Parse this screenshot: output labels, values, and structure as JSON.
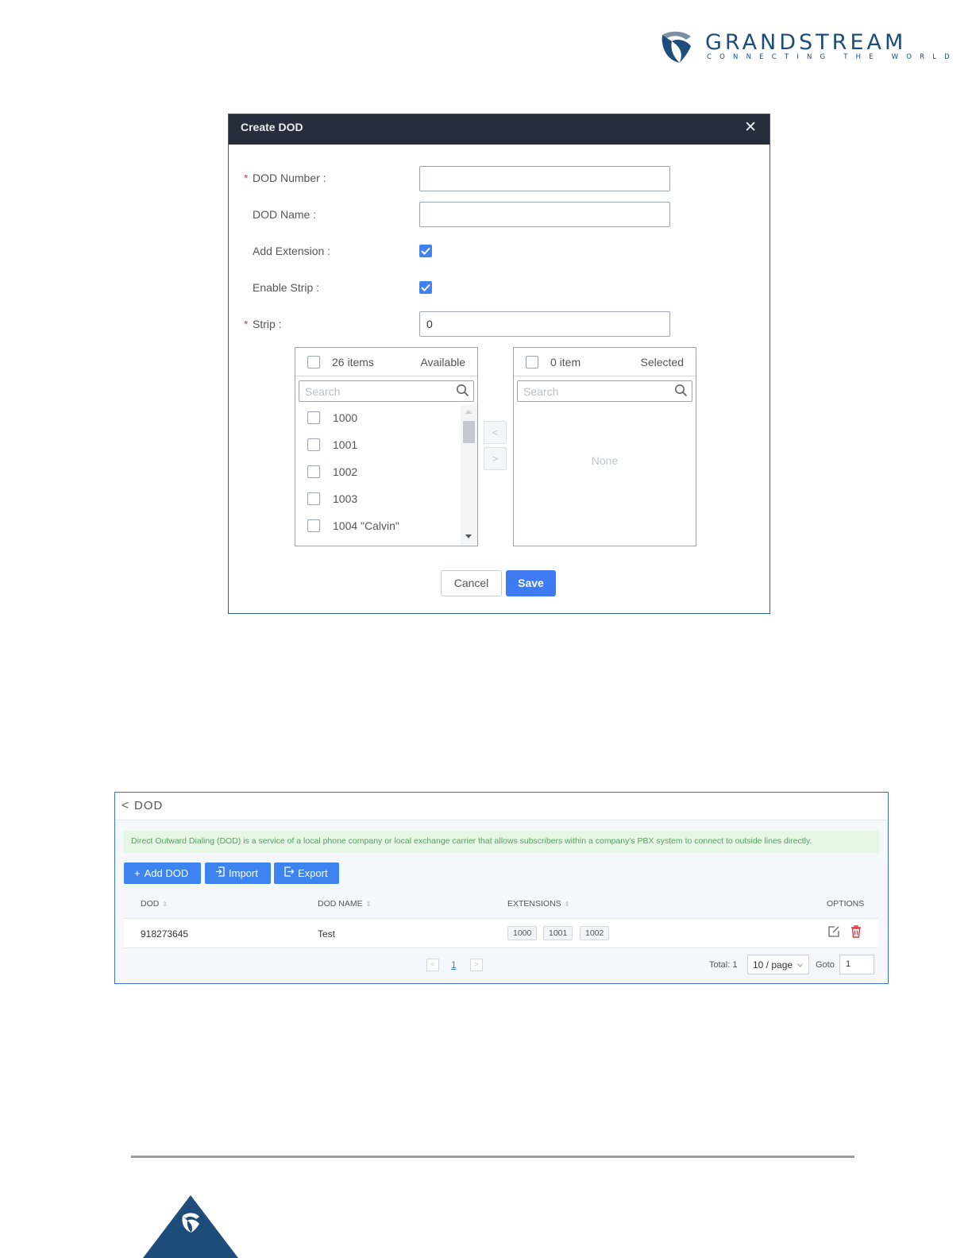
{
  "brand": {
    "name": "GRANDSTREAM",
    "tagline": "CONNECTING THE WORLD",
    "colors": {
      "primary": "#1e4d7b",
      "accent": "#3e7af2"
    }
  },
  "dialog": {
    "title": "Create DOD",
    "close_label": "✕",
    "fields": {
      "dod_number": {
        "label": "DOD Number :",
        "value": ""
      },
      "dod_name": {
        "label": "DOD Name :",
        "value": ""
      },
      "add_extension": {
        "label": "Add Extension :",
        "checked": true
      },
      "enable_strip": {
        "label": "Enable Strip :",
        "checked": true
      },
      "strip": {
        "label": "Strip :",
        "value": "0"
      }
    },
    "required_mark": "*",
    "available": {
      "count": "26 items",
      "title": "Available",
      "search_placeholder": "Search",
      "items": [
        "1000",
        "1001",
        "1002",
        "1003",
        "1004 \"Calvin\""
      ]
    },
    "selected": {
      "count": "0 item",
      "title": "Selected",
      "search_placeholder": "Search",
      "empty_text": "None"
    },
    "move_left": "<",
    "move_right": ">",
    "cancel_label": "Cancel",
    "save_label": "Save"
  },
  "dod_page": {
    "back": "<",
    "title": "DOD",
    "notice": "Direct Outward Dialing (DOD) is a service of a local phone company or local exchange carrier that allows subscribers within a company's PBX system to connect to outside lines directly.",
    "buttons": {
      "add": "Add DOD",
      "import": "Import",
      "export": "Export"
    },
    "columns": [
      "DOD",
      "DOD NAME",
      "EXTENSIONS",
      "OPTIONS"
    ],
    "sort_icon": "⇕",
    "rows": [
      {
        "dod": "918273645",
        "name": "Test",
        "extensions": [
          "1000",
          "1001",
          "1002"
        ]
      }
    ],
    "pagination": {
      "prev": "<",
      "current": "1",
      "next": ">",
      "total": "Total: 1",
      "page_size": "10 / page",
      "goto_label": "Goto",
      "goto_value": "1"
    }
  }
}
